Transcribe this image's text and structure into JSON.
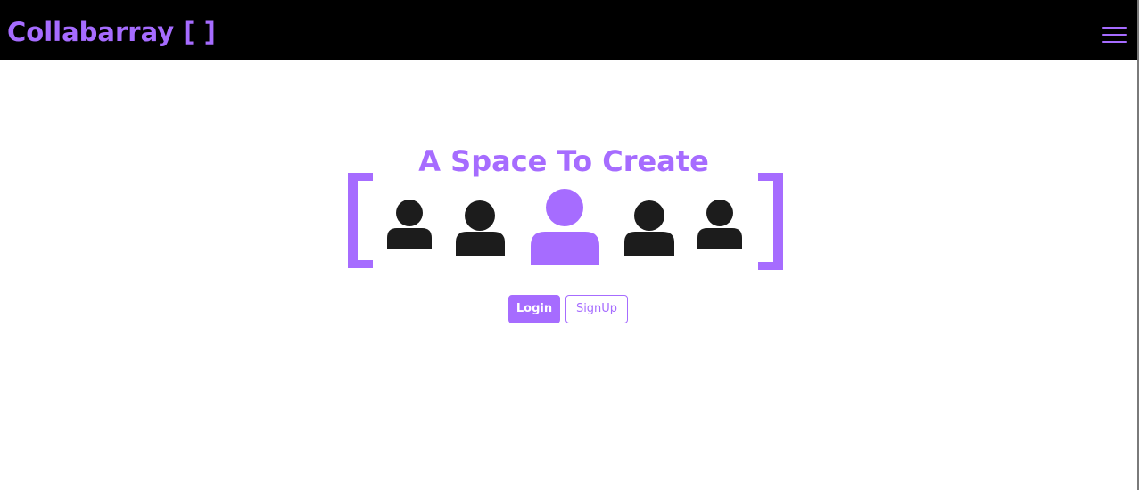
{
  "navbar": {
    "brand": "Collabarray [ ]",
    "menu_icon": "hamburger-menu-icon",
    "background": "#000000"
  },
  "hero": {
    "title": "A Space To Create",
    "graphic": {
      "brackets": "[ ]",
      "people_icons": [
        "person-icon",
        "person-icon",
        "person-icon-highlighted",
        "person-icon",
        "person-icon"
      ],
      "highlight_index": 2
    }
  },
  "auth": {
    "login_label": "Login",
    "signup_label": "SignUp"
  },
  "colors": {
    "accent": "#a66cff",
    "person_dark": "#1c1c1c",
    "background": "#ffffff"
  }
}
